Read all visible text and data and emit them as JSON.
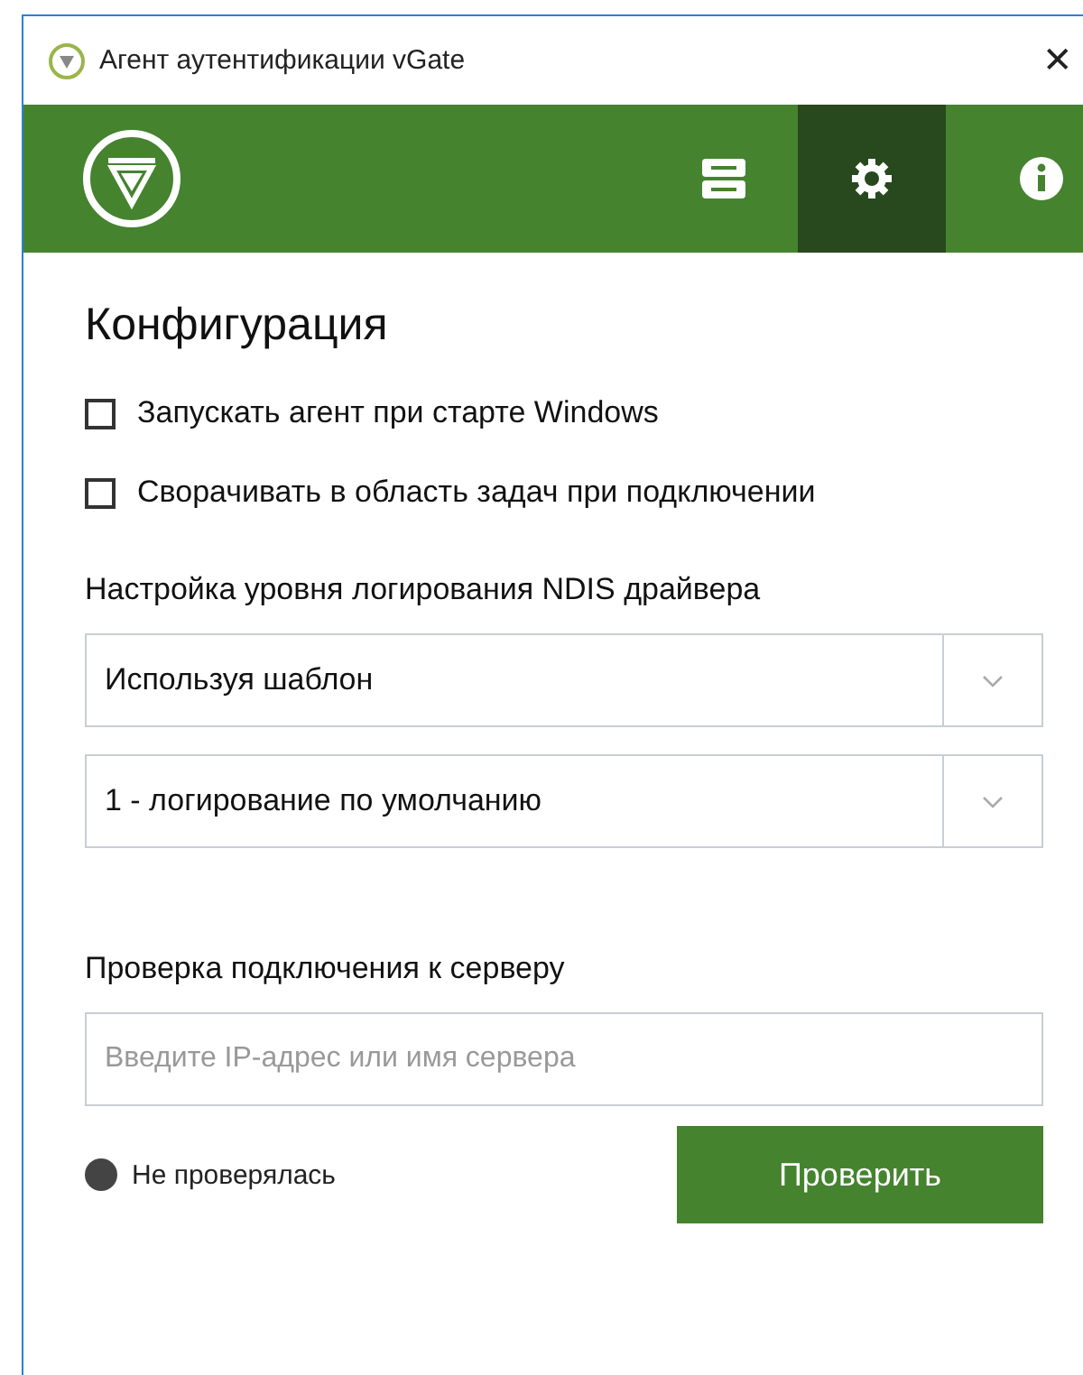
{
  "window": {
    "title": "Агент аутентификации vGate",
    "close": "✕"
  },
  "toolbar": {
    "buttons": [
      {
        "kind": "server",
        "selected": false
      },
      {
        "kind": "settings",
        "selected": true
      },
      {
        "kind": "info",
        "selected": false
      }
    ]
  },
  "heading": "Конфигурация",
  "options": [
    {
      "label": "Запускать агент при старте Windows",
      "checked": false
    },
    {
      "label": "Сворачивать в область задач при подключении",
      "checked": false
    }
  ],
  "logging": {
    "title": "Настройка уровня логирования NDIS драйвера",
    "dropdowns": [
      {
        "value": "Используя шаблон"
      },
      {
        "value": "1 - логирование по умолчанию"
      }
    ]
  },
  "connection": {
    "title": "Проверка подключения к серверу",
    "placeholder": "Введите IP-адрес или имя сервера",
    "status": {
      "text": "Не проверялась",
      "color": "#444444"
    },
    "button": "Проверить"
  }
}
